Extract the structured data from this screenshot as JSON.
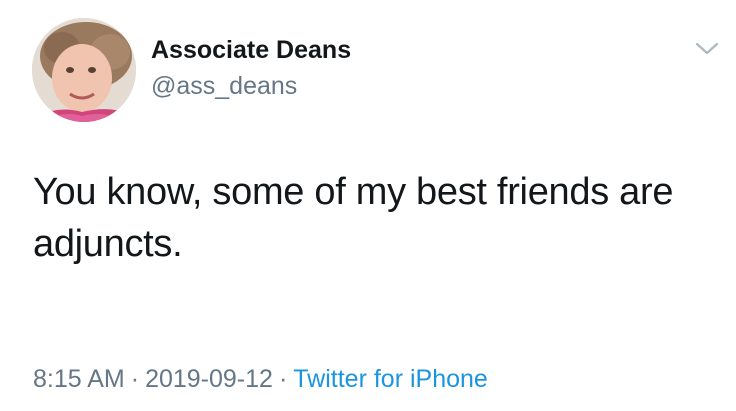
{
  "tweet": {
    "display_name": "Associate Deans",
    "handle": "@ass_deans",
    "text": "You know, some of my best friends are adjuncts.",
    "time": "8:15 AM",
    "separator": "·",
    "date": "2019-09-12",
    "source": "Twitter for iPhone"
  },
  "icons": {
    "menu": "chevron-down-icon",
    "avatar": "profile-photo"
  },
  "colors": {
    "name": "#14171a",
    "secondary": "#657786",
    "link": "#1b95e0",
    "background": "#ffffff"
  }
}
